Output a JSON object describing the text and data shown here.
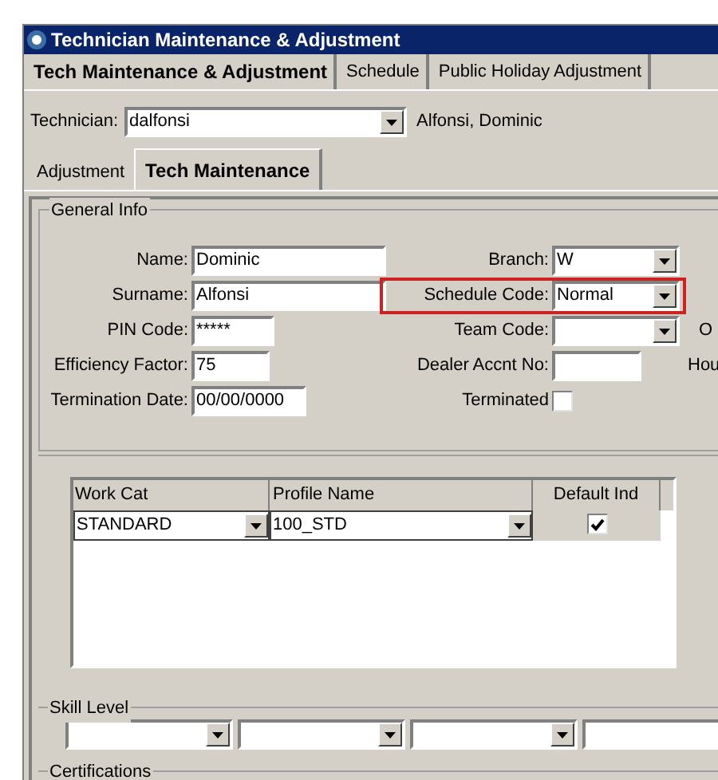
{
  "window": {
    "title": "Technician Maintenance & Adjustment"
  },
  "tabs": [
    {
      "label": "Tech Maintenance & Adjustment",
      "selected": true
    },
    {
      "label": "Schedule",
      "selected": false
    },
    {
      "label": "Public Holiday Adjustment",
      "selected": false
    }
  ],
  "technician": {
    "label": "Technician:",
    "value": "dalfonsi",
    "full_name": "Alfonsi, Dominic"
  },
  "sub_tabs": [
    {
      "label": "Adjustment",
      "selected": false
    },
    {
      "label": "Tech Maintenance",
      "selected": true
    }
  ],
  "general_info": {
    "title": "General Info",
    "left_fields": [
      {
        "label": "Name:",
        "value": "Dominic"
      },
      {
        "label": "Surname:",
        "value": "Alfonsi"
      },
      {
        "label": "PIN Code:",
        "value": "*****"
      },
      {
        "label": "Efficiency Factor:",
        "value": "75"
      },
      {
        "label": "Termination Date:",
        "value": "00/00/0000"
      }
    ],
    "right_fields": [
      {
        "kind": "dropdown",
        "label": "Branch:",
        "value": "W",
        "highlighted": false
      },
      {
        "kind": "dropdown",
        "label": "Schedule Code:",
        "value": "Normal",
        "highlighted": true
      },
      {
        "kind": "dropdown",
        "label": "Team Code:",
        "highlighted": false,
        "extra_label": "O"
      },
      {
        "kind": "text",
        "label": "Dealer Accnt No:",
        "highlighted": false,
        "extra_label": "Hou"
      },
      {
        "kind": "checkbox",
        "label": "Terminated",
        "checked": false,
        "highlighted": false
      }
    ]
  },
  "work_table": {
    "columns": [
      "Work Cat",
      "Profile Name",
      "Default Ind"
    ],
    "rows": [
      {
        "work_cat": "STANDARD",
        "profile_name": "100_STD",
        "default_ind": true
      }
    ]
  },
  "skill_level": {
    "title": "Skill Level"
  },
  "certifications": {
    "title": "Certifications"
  }
}
